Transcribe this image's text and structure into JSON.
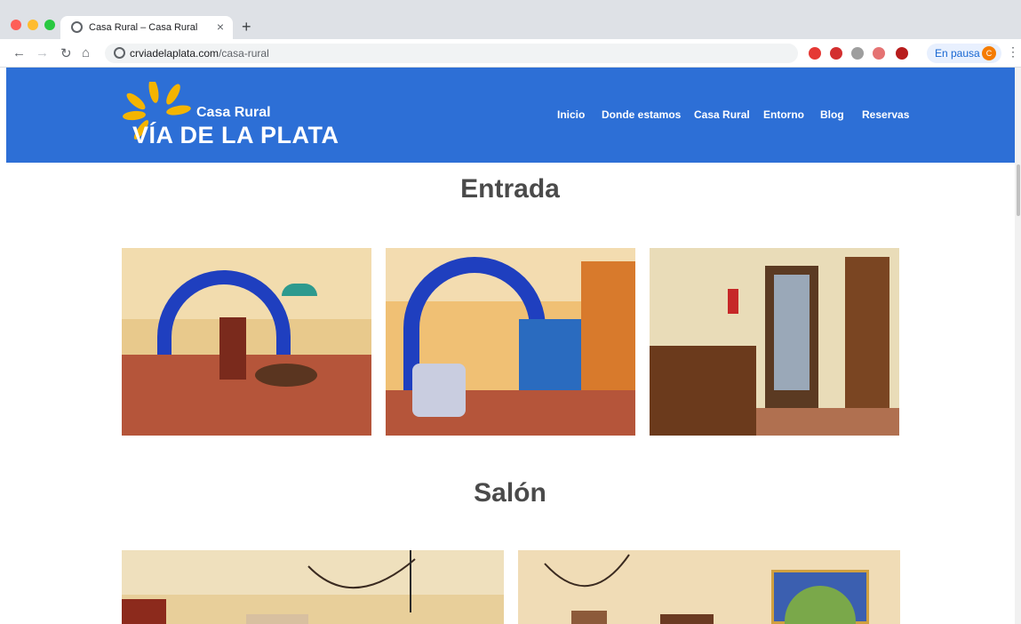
{
  "browser": {
    "tab_title": "Casa Rural – Casa Rural",
    "tab_close": "×",
    "new_tab": "+",
    "url_host": "crviadelaplata.com",
    "url_path": "/casa-rural",
    "pause_label": "En pausa",
    "profile_initial": "C",
    "extensions": [
      "opera-icon",
      "adblock-plus-icon",
      "chat-icon",
      "color-icon",
      "shield-icon"
    ]
  },
  "site": {
    "logo_sub": "Casa Rural",
    "logo_main": "VÍA DE LA PLATA",
    "brand_color": "#2d6fd6",
    "nav": [
      "Inicio",
      "Donde estamos",
      "Casa Rural",
      "Entorno",
      "Blog",
      "Reservas"
    ]
  },
  "sections": [
    {
      "title": "Entrada"
    },
    {
      "title": "Salón"
    }
  ]
}
